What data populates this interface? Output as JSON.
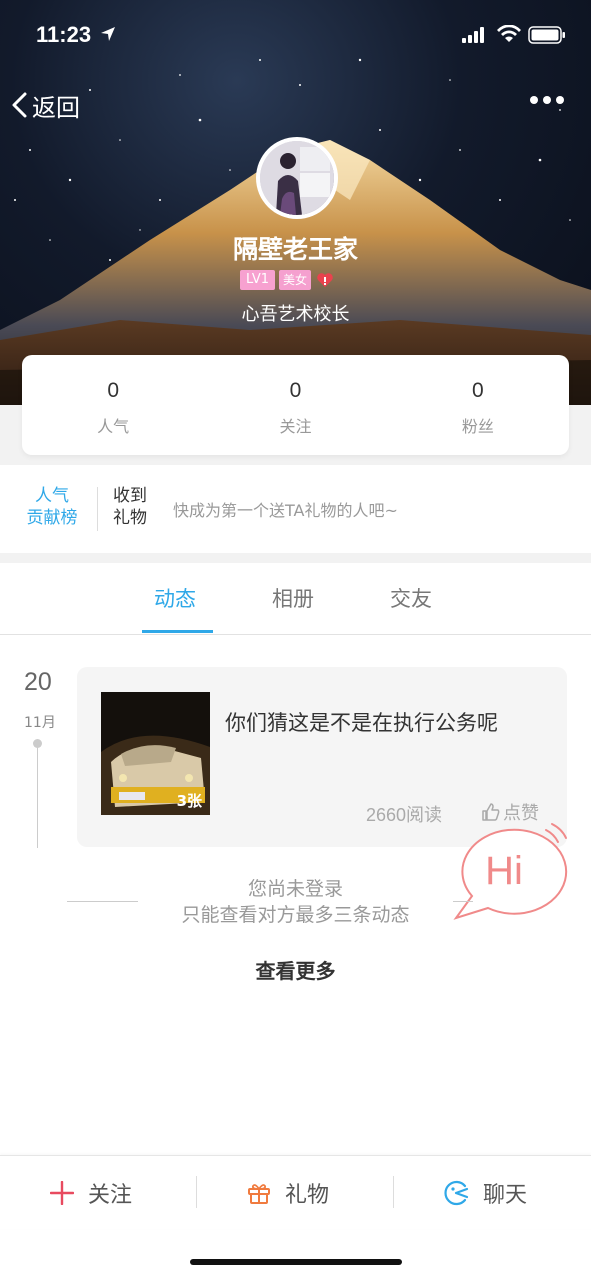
{
  "status_bar": {
    "time": "11:23"
  },
  "header": {
    "back_label": "返回",
    "user_name": "隔壁老王家",
    "level_badge": "LV1",
    "gender_badge": "美女",
    "subtitle": "心吾艺术校长"
  },
  "stats": [
    {
      "value": "0",
      "label": "人气"
    },
    {
      "value": "0",
      "label": "关注"
    },
    {
      "value": "0",
      "label": "粉丝"
    }
  ],
  "gifts": {
    "rank_line1": "人气",
    "rank_line2": "贡献榜",
    "received_line1": "收到",
    "received_line2": "礼物",
    "hint": "快成为第一个送TA礼物的人吧~"
  },
  "tabs": [
    {
      "label": "动态",
      "active": true
    },
    {
      "label": "相册",
      "active": false
    },
    {
      "label": "交友",
      "active": false
    }
  ],
  "feed": {
    "day": "20",
    "month": "11月",
    "post": {
      "text": "你们猜这是不是在执行公务呢",
      "image_count": "3张",
      "reads": "2660阅读",
      "like_label": "点赞"
    }
  },
  "hi_bubble": {
    "text": "Hi"
  },
  "notice": {
    "line1": "您尚未登录",
    "line2": "只能查看对方最多三条动态"
  },
  "see_more": "查看更多",
  "bottom_bar": {
    "follow": "关注",
    "gift": "礼物",
    "chat": "聊天"
  },
  "colors": {
    "accent": "#2fa8e8",
    "follow_icon": "#e84a5f",
    "gift_icon": "#f07b3f",
    "chat_icon": "#2fa8e8",
    "hi_pink": "#f08a8a",
    "badge_pink": "#f7a1d0"
  }
}
